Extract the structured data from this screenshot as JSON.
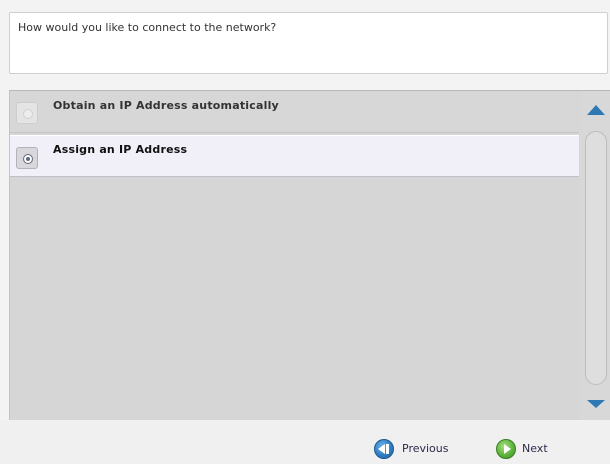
{
  "question": {
    "text": "How would you like to connect to the network?"
  },
  "options": [
    {
      "label": "Obtain an IP Address automatically",
      "selected": false
    },
    {
      "label": "Assign an IP Address",
      "selected": true
    }
  ],
  "scrollbar": {
    "up_icon": "arrow-up-icon",
    "down_icon": "arrow-down-icon"
  },
  "navigation": {
    "previous_label": "Previous",
    "next_label": "Next",
    "previous_icon": "previous-icon",
    "next_icon": "next-icon"
  },
  "colors": {
    "accent_blue": "#2e79b4",
    "next_green": "#5fb43d",
    "selected_row": "#f1eff8"
  }
}
